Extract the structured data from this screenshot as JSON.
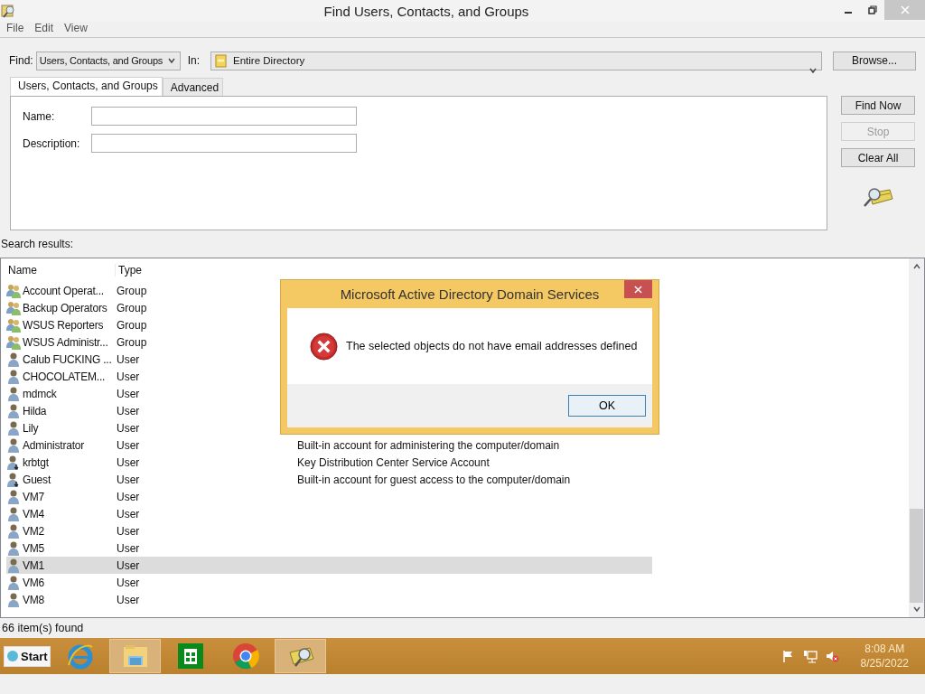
{
  "window": {
    "title": "Find Users, Contacts, and Groups"
  },
  "menu": [
    "File",
    "Edit",
    "View"
  ],
  "find": {
    "label": "Find:",
    "value": "Users, Contacts, and Groups"
  },
  "in": {
    "label": "In:",
    "value": "Entire Directory"
  },
  "browse_button": "Browse...",
  "tabs": [
    {
      "label": "Users, Contacts, and Groups",
      "selected": true
    },
    {
      "label": "Advanced",
      "selected": false
    }
  ],
  "fields": [
    {
      "label": "Name:"
    },
    {
      "label": "Description:"
    }
  ],
  "buttons": [
    {
      "label": "Find Now",
      "disabled": false
    },
    {
      "label": "Stop",
      "disabled": true
    },
    {
      "label": "Clear All",
      "disabled": false
    }
  ],
  "results_label": "Search results:",
  "table": {
    "columns": [
      "Name",
      "Type"
    ],
    "rows": [
      {
        "kind": "group",
        "name": "Account Operat...",
        "type": "Group",
        "selected": false
      },
      {
        "kind": "group",
        "name": "Backup Operators",
        "type": "Group",
        "selected": false
      },
      {
        "kind": "group",
        "name": "WSUS Reporters",
        "type": "Group",
        "selected": false
      },
      {
        "kind": "group",
        "name": "WSUS Administr...",
        "type": "Group",
        "selected": false
      },
      {
        "kind": "user",
        "name": "Calub FUCKING ...",
        "type": "User",
        "selected": false
      },
      {
        "kind": "user",
        "name": "CHOCOLATEM...",
        "type": "User",
        "selected": false
      },
      {
        "kind": "user",
        "name": "mdmck",
        "type": "User",
        "selected": false
      },
      {
        "kind": "user",
        "name": "Hilda",
        "type": "User",
        "selected": false
      },
      {
        "kind": "user",
        "name": "Lily",
        "type": "User",
        "selected": false
      },
      {
        "kind": "user",
        "name": "Administrator",
        "type": "User",
        "description": "Built-in account for administering the computer/domain",
        "selected": false
      },
      {
        "kind": "disabled_user",
        "name": "krbtgt",
        "type": "User",
        "description": "Key Distribution Center Service Account",
        "selected": false
      },
      {
        "kind": "disabled_user",
        "name": "Guest",
        "type": "User",
        "description": "Built-in account for guest access to the computer/domain",
        "selected": false
      },
      {
        "kind": "user",
        "name": "VM7",
        "type": "User",
        "selected": false
      },
      {
        "kind": "user",
        "name": "VM4",
        "type": "User",
        "selected": false
      },
      {
        "kind": "user",
        "name": "VM2",
        "type": "User",
        "selected": false
      },
      {
        "kind": "user",
        "name": "VM5",
        "type": "User",
        "selected": false
      },
      {
        "kind": "user",
        "name": "VM1",
        "type": "User",
        "selected": true
      },
      {
        "kind": "user",
        "name": "VM6",
        "type": "User",
        "selected": false
      },
      {
        "kind": "user",
        "name": "VM8",
        "type": "User",
        "selected": false
      }
    ]
  },
  "status_bar": "66 item(s) found",
  "dialog": {
    "title": "Microsoft Active Directory Domain Services",
    "message": "The selected objects do not have email addresses defined",
    "button": "OK"
  },
  "taskbar": {
    "start": "Start",
    "apps": [
      {
        "kind": "browser",
        "active": false
      },
      {
        "kind": "explorer",
        "active": true
      },
      {
        "kind": "store",
        "active": false
      },
      {
        "kind": "chrome",
        "active": false
      },
      {
        "kind": "find",
        "active": true
      }
    ],
    "clock": {
      "time": "8:08 AM",
      "date": "8/25/2022"
    }
  }
}
